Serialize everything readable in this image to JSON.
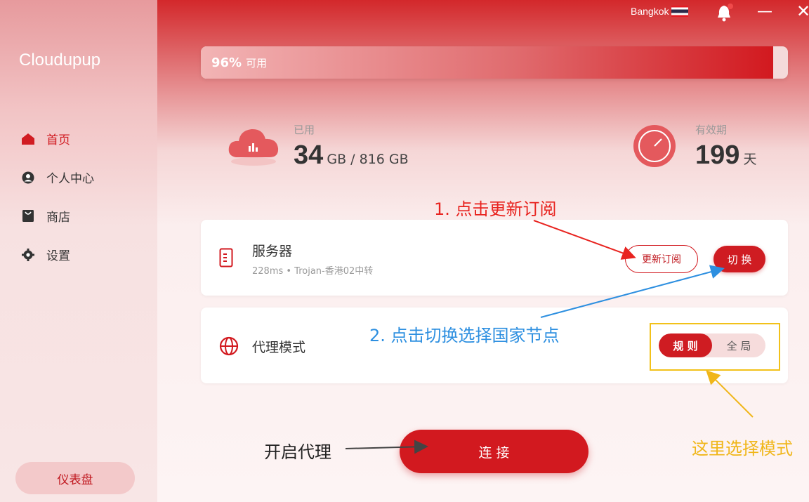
{
  "app": {
    "name": "Cloudupup"
  },
  "sidebar": {
    "items": [
      {
        "label": "首页",
        "icon": "home-icon",
        "active": true
      },
      {
        "label": "个人中心",
        "icon": "user-icon",
        "active": false
      },
      {
        "label": "商店",
        "icon": "store-icon",
        "active": false
      },
      {
        "label": "设置",
        "icon": "gear-icon",
        "active": false
      }
    ],
    "dashboard_label": "仪表盘"
  },
  "topbar": {
    "location": "Bangkok"
  },
  "usage": {
    "percent_text": "96%",
    "available_label": "可用",
    "remaining_fraction": 0.975
  },
  "stats": {
    "used_label": "已用",
    "used_value": "34",
    "used_detail": "GB / 816 GB",
    "valid_label": "有效期",
    "valid_value": "199",
    "valid_unit": "天"
  },
  "server": {
    "title": "服务器",
    "subtitle": "228ms • Trojan-香港02中转",
    "update_label": "更新订阅",
    "switch_label": "切 换"
  },
  "proxy": {
    "title": "代理模式",
    "modes": [
      {
        "label": "规 则",
        "selected": true
      },
      {
        "label": "全 局",
        "selected": false
      }
    ]
  },
  "connect_label": "连 接",
  "annotations": {
    "step1": "1. 点击更新订阅",
    "step2": "2. 点击切换选择国家节点",
    "mode_hint": "这里选择模式",
    "start_hint": "开启代理"
  },
  "colors": {
    "accent": "#d2191f",
    "annotation_red": "#e8231f",
    "annotation_blue": "#2d8fe0",
    "annotation_yellow": "#f0b619"
  }
}
